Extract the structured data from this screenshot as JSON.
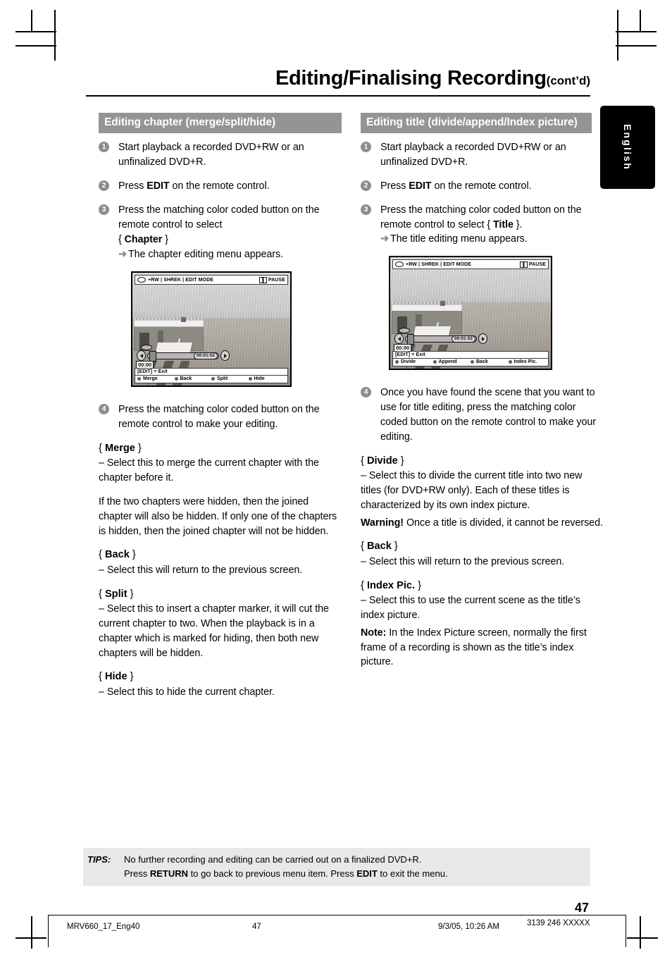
{
  "header": {
    "title": "Editing/Finalising Recording",
    "contd": "(cont’d)"
  },
  "language_tab": "English",
  "left_column": {
    "section_heading": "Editing chapter (merge/split/hide)",
    "steps": [
      {
        "num": "1",
        "text": "Start playback a recorded DVD+RW or an unfinalized DVD+R."
      },
      {
        "num": "2",
        "text_before": "Press ",
        "bold": "EDIT",
        "text_after": " on the remote control."
      },
      {
        "num": "3",
        "text_before": "Press the matching color coded button on the remote control to select",
        "brace_open": "{ ",
        "bold": "Chapter",
        "brace_close": " }",
        "arrow": "➜",
        "arrow_text": "The chapter editing menu appears."
      }
    ],
    "tv_screen": {
      "status_left": "+RW | SHREK | EDIT MODE",
      "status_right": "PAUSE",
      "disc_icon": "disc-icon",
      "pause_icon": "pause-icon",
      "elapsed_time": "00:00",
      "total_time": "00:01:02",
      "exit_hint": "[EDIT] = Exit",
      "buttons": [
        "Merge",
        "Back",
        "Split",
        "Hide"
      ]
    },
    "step4": {
      "num": "4",
      "text": "Press the matching color coded button on the remote control to make your editing."
    },
    "options": [
      {
        "title_open": "{ ",
        "title": "Merge",
        "title_close": " }",
        "desc": "–  Select this to merge the current chapter with the chapter before it.",
        "extra": "If the two chapters were hidden, then the joined chapter will also be hidden.  If only one of the chapters is hidden, then the joined chapter will not be hidden."
      },
      {
        "title_open": "{ ",
        "title": "Back",
        "title_close": " }",
        "desc": "–  Select this will return to the previous screen.",
        "extra": ""
      },
      {
        "title_open": "{ ",
        "title": "Split",
        "title_close": " }",
        "desc": "–  Select this to insert a chapter marker, it will cut the current chapter to two. When the playback is in a chapter which is marked for hiding, then both new chapters will be hidden.",
        "extra": ""
      },
      {
        "title_open": "{ ",
        "title": "Hide",
        "title_close": " }",
        "desc": "–  Select this to hide the current chapter.",
        "extra": ""
      }
    ]
  },
  "right_column": {
    "section_heading": "Editing title (divide/append/Index picture)",
    "steps": [
      {
        "num": "1",
        "text": "Start playback a recorded DVD+RW or an unfinalized DVD+R."
      },
      {
        "num": "2",
        "text_before": "Press ",
        "bold": "EDIT",
        "text_after": " on the remote control."
      },
      {
        "num": "3",
        "text_before": "Press the matching color coded button on the remote control to select { ",
        "bold": "Title",
        "text_after": " }.",
        "arrow": "➜",
        "arrow_text": "The title editing menu appears."
      }
    ],
    "tv_screen": {
      "status_left": "+RW | SHREK | EDIT MODE",
      "status_right": "PAUSE",
      "disc_icon": "disc-icon",
      "pause_icon": "pause-icon",
      "elapsed_time": "00:00",
      "total_time": "00:01:02",
      "exit_hint": "[EDIT] = Exit",
      "buttons": [
        "Divide",
        "Append",
        "Back",
        "Index Pic."
      ]
    },
    "step4": {
      "num": "4",
      "text": "Once you have found the scene that you want to use for title editing, press the matching color coded button on the remote control to make your editing."
    },
    "options": [
      {
        "title_open": "{ ",
        "title": "Divide",
        "title_close": " }",
        "desc": "–  Select this to divide the current title into two new titles (for DVD+RW only). Each of these titles is characterized by its own index picture.",
        "warn_label": "Warning!",
        "warn_text": " Once a title is divided, it cannot be reversed."
      },
      {
        "title_open": "{ ",
        "title": "Back",
        "title_close": " }",
        "desc": "–  Select this will return to the previous screen.",
        "warn_label": "",
        "warn_text": ""
      },
      {
        "title_open": "{ ",
        "title": "Index Pic.",
        "title_close": " }",
        "desc": "–  Select this to use the current scene as the title’s index picture.",
        "warn_label": "Note:",
        "warn_text": "  In the Index Picture screen, normally the first frame of a recording is shown as the title’s index picture."
      }
    ]
  },
  "tips": {
    "label": "TIPS:",
    "line1": "No further recording and editing can be carried out on a finalized DVD+R.",
    "line2_a": "Press ",
    "line2_b": "RETURN",
    "line2_c": " to go back to previous menu item.  Press ",
    "line2_d": "EDIT",
    "line2_e": " to exit the menu."
  },
  "page_number": "47",
  "footer": {
    "file": "MRV660_17_Eng40",
    "page": "47",
    "date": "9/3/05, 10:26 AM",
    "code": "3139 246 XXXXX"
  }
}
